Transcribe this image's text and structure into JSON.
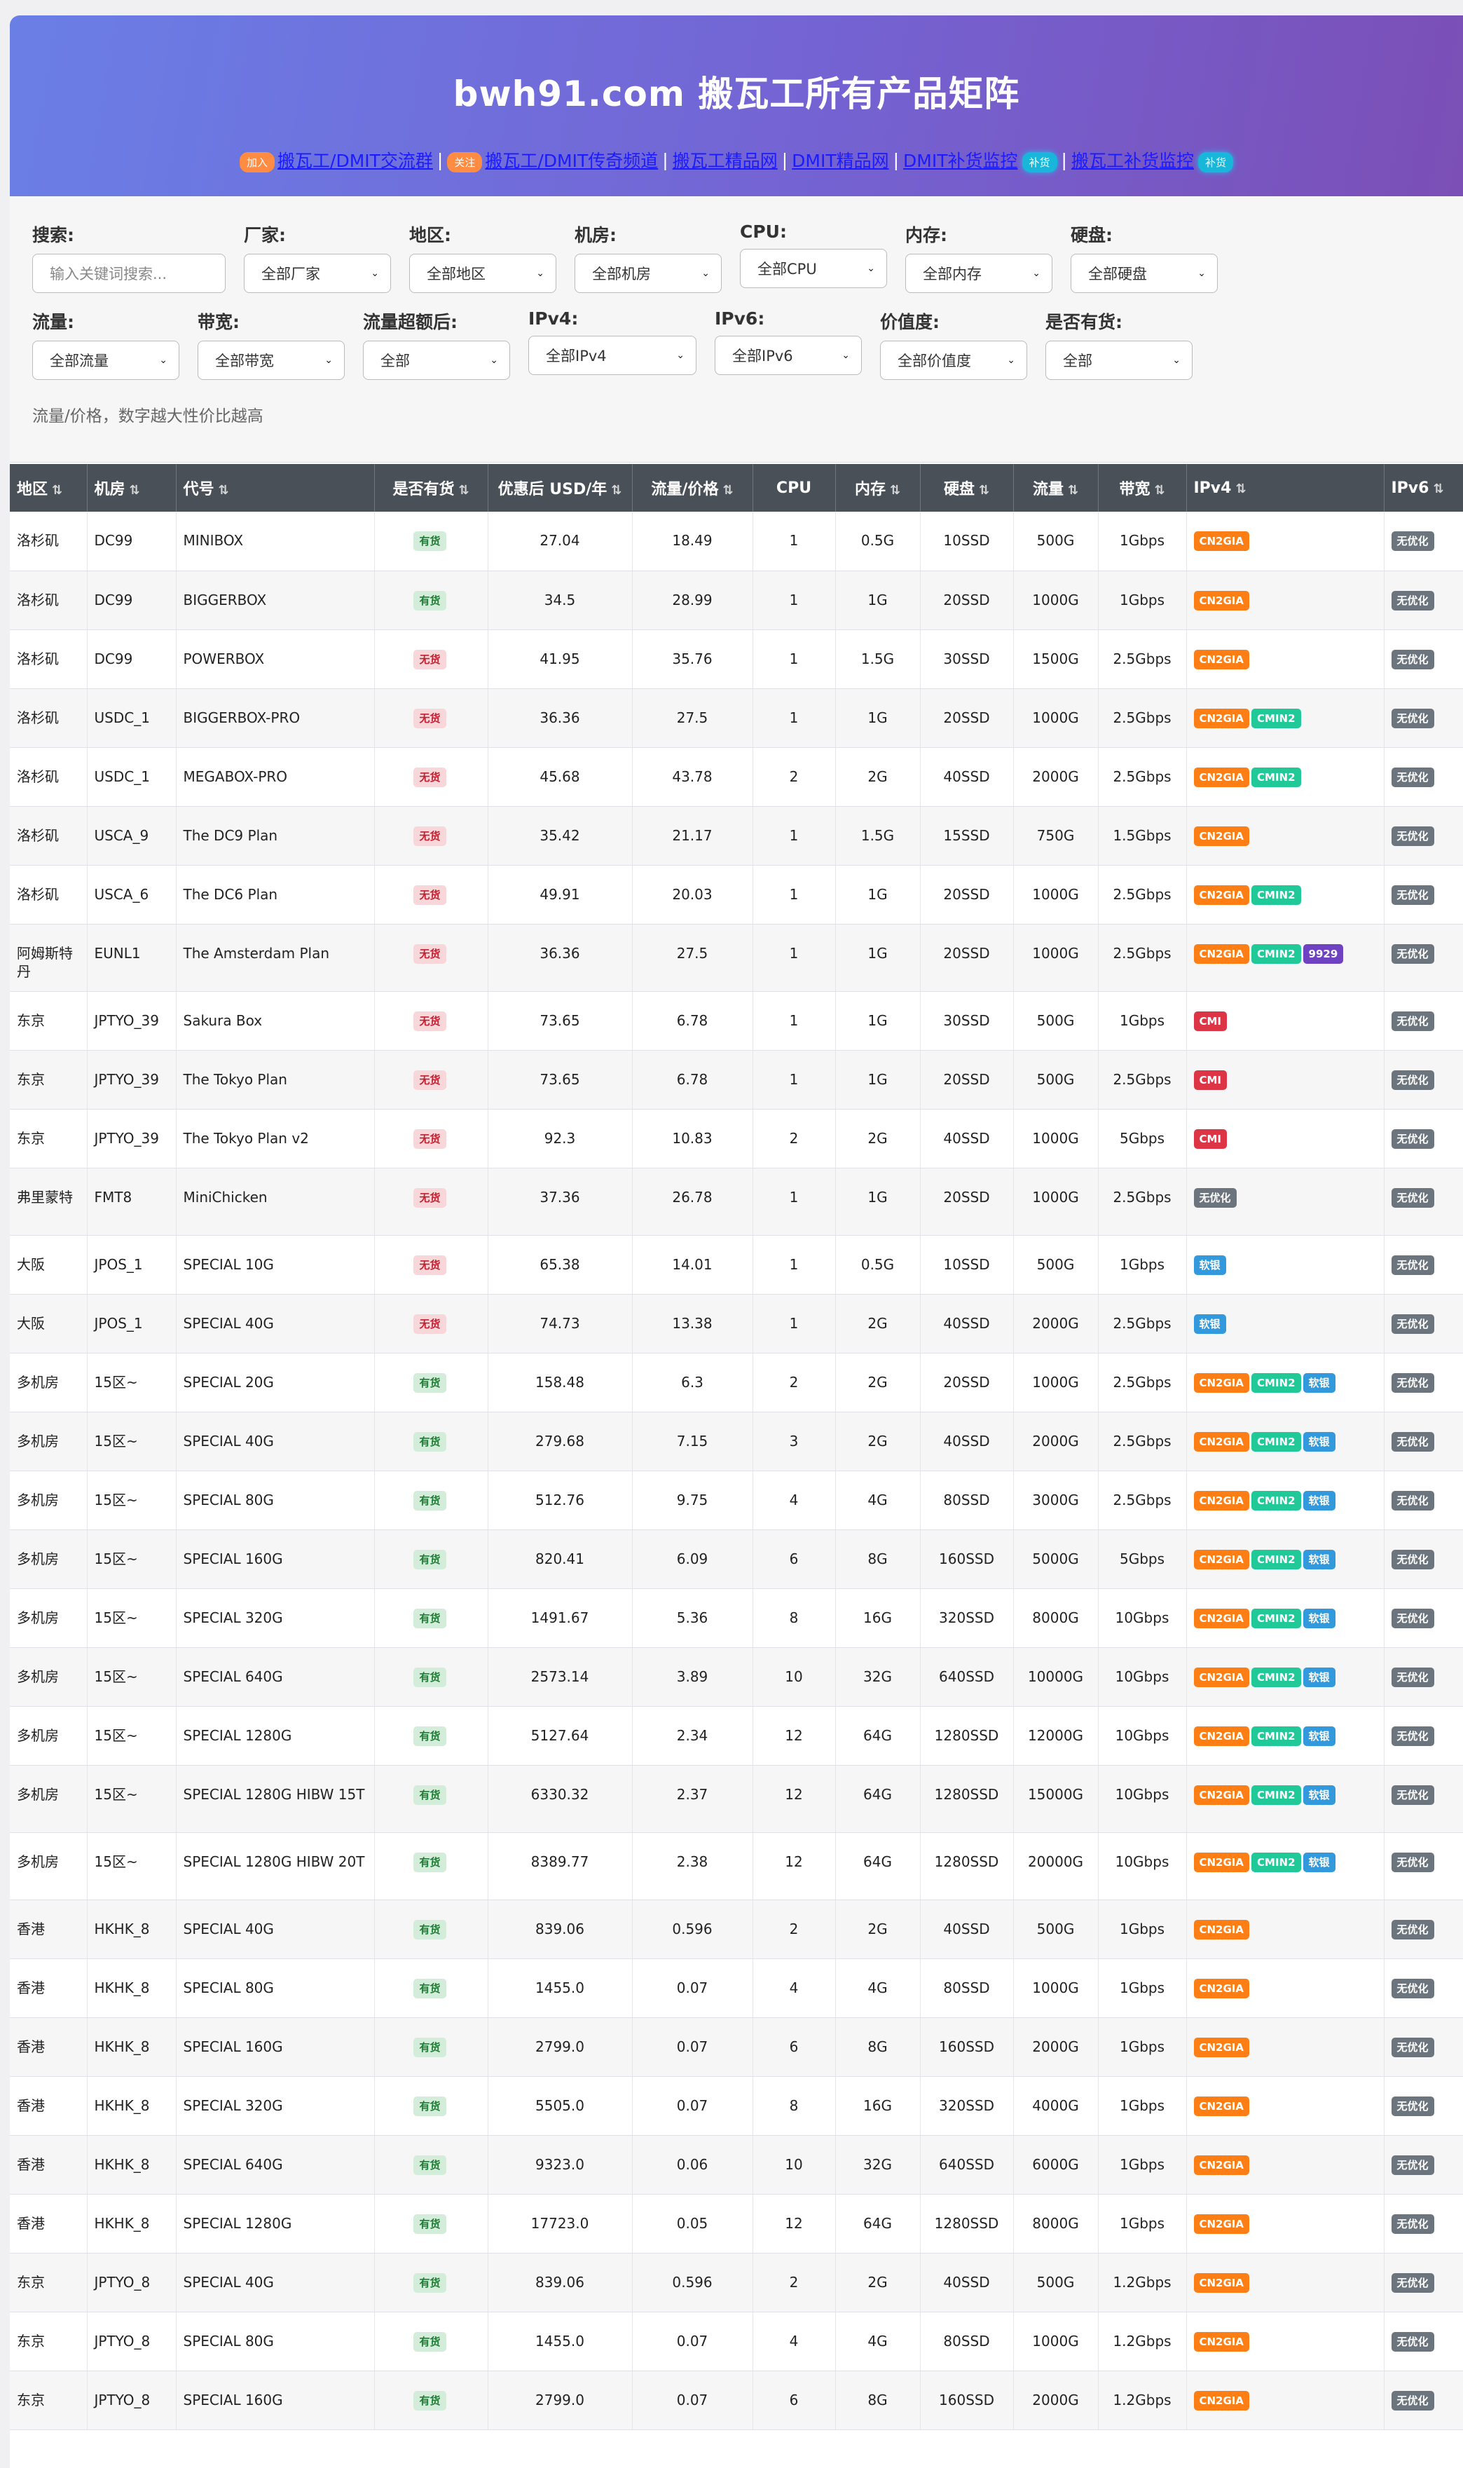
{
  "header": {
    "title": "bwh91.com 搬瓦工所有产品矩阵",
    "links": [
      {
        "pill": "加入",
        "pill_color": "orange",
        "text": "搬瓦工/DMIT交流群",
        "suffix": ""
      },
      {
        "pill": "关注",
        "pill_color": "orange",
        "text": "搬瓦工/DMIT传奇频道",
        "suffix": ""
      },
      {
        "pill": "",
        "pill_color": "",
        "text": "搬瓦工精品网",
        "suffix": ""
      },
      {
        "pill": "",
        "pill_color": "",
        "text": "DMIT精品网",
        "suffix": ""
      },
      {
        "pill": "",
        "pill_color": "",
        "text": "DMIT补货监控",
        "suffix": "补货"
      },
      {
        "pill": "",
        "pill_color": "",
        "text": "搬瓦工补货监控",
        "suffix": "补货"
      }
    ],
    "separator": "|"
  },
  "filters": {
    "row1": [
      {
        "label": "搜索:",
        "type": "input",
        "value": "",
        "placeholder": "输入关键词搜索..."
      },
      {
        "label": "厂家:",
        "type": "select",
        "value": "全部厂家"
      },
      {
        "label": "地区:",
        "type": "select",
        "value": "全部地区"
      },
      {
        "label": "机房:",
        "type": "select",
        "value": "全部机房"
      },
      {
        "label": "CPU:",
        "type": "select",
        "value": "全部CPU"
      },
      {
        "label": "内存:",
        "type": "select",
        "value": "全部内存"
      },
      {
        "label": "硬盘:",
        "type": "select",
        "value": "全部硬盘"
      }
    ],
    "row2": [
      {
        "label": "流量:",
        "type": "select",
        "value": "全部流量"
      },
      {
        "label": "带宽:",
        "type": "select",
        "value": "全部带宽"
      },
      {
        "label": "流量超额后:",
        "type": "select",
        "value": "全部"
      },
      {
        "label": "IPv4:",
        "type": "select",
        "value": "全部IPv4"
      },
      {
        "label": "IPv6:",
        "type": "select",
        "value": "全部IPv6"
      },
      {
        "label": "价值度:",
        "type": "select",
        "value": "全部价值度"
      },
      {
        "label": "是否有货:",
        "type": "select",
        "value": "全部"
      }
    ],
    "note": "流量/价格，数字越大性价比越高"
  },
  "table": {
    "columns": [
      "地区",
      "机房",
      "代号",
      "是否有货",
      "优惠后 USD/年",
      "流量/价格",
      "CPU",
      "内存",
      "硬盘",
      "流量",
      "带宽",
      "IPv4",
      "IPv6"
    ],
    "rows": [
      {
        "region": "洛杉矶",
        "dc": "DC99",
        "code": "MINIBOX",
        "stock": "有货",
        "price": "27.04",
        "ratio": "18.49",
        "cpu": "1",
        "ram": "0.5G",
        "disk": "10SSD",
        "traffic": "500G",
        "bw": "1Gbps",
        "ipv4": [
          "CN2GIA"
        ],
        "ipv6": [
          "无优化"
        ]
      },
      {
        "region": "洛杉矶",
        "dc": "DC99",
        "code": "BIGGERBOX",
        "stock": "有货",
        "price": "34.5",
        "ratio": "28.99",
        "cpu": "1",
        "ram": "1G",
        "disk": "20SSD",
        "traffic": "1000G",
        "bw": "1Gbps",
        "ipv4": [
          "CN2GIA"
        ],
        "ipv6": [
          "无优化"
        ]
      },
      {
        "region": "洛杉矶",
        "dc": "DC99",
        "code": "POWERBOX",
        "stock": "无货",
        "price": "41.95",
        "ratio": "35.76",
        "cpu": "1",
        "ram": "1.5G",
        "disk": "30SSD",
        "traffic": "1500G",
        "bw": "2.5Gbps",
        "ipv4": [
          "CN2GIA"
        ],
        "ipv6": [
          "无优化"
        ]
      },
      {
        "region": "洛杉矶",
        "dc": "USDC_1",
        "code": "BIGGERBOX-PRO",
        "stock": "无货",
        "price": "36.36",
        "ratio": "27.5",
        "cpu": "1",
        "ram": "1G",
        "disk": "20SSD",
        "traffic": "1000G",
        "bw": "2.5Gbps",
        "ipv4": [
          "CN2GIA",
          "CMIN2"
        ],
        "ipv6": [
          "无优化"
        ]
      },
      {
        "region": "洛杉矶",
        "dc": "USDC_1",
        "code": "MEGABOX-PRO",
        "stock": "无货",
        "price": "45.68",
        "ratio": "43.78",
        "cpu": "2",
        "ram": "2G",
        "disk": "40SSD",
        "traffic": "2000G",
        "bw": "2.5Gbps",
        "ipv4": [
          "CN2GIA",
          "CMIN2"
        ],
        "ipv6": [
          "无优化"
        ]
      },
      {
        "region": "洛杉矶",
        "dc": "USCA_9",
        "code": "The DC9 Plan",
        "stock": "无货",
        "price": "35.42",
        "ratio": "21.17",
        "cpu": "1",
        "ram": "1.5G",
        "disk": "15SSD",
        "traffic": "750G",
        "bw": "1.5Gbps",
        "ipv4": [
          "CN2GIA"
        ],
        "ipv6": [
          "无优化"
        ]
      },
      {
        "region": "洛杉矶",
        "dc": "USCA_6",
        "code": "The DC6 Plan",
        "stock": "无货",
        "price": "49.91",
        "ratio": "20.03",
        "cpu": "1",
        "ram": "1G",
        "disk": "20SSD",
        "traffic": "1000G",
        "bw": "2.5Gbps",
        "ipv4": [
          "CN2GIA",
          "CMIN2"
        ],
        "ipv6": [
          "无优化"
        ]
      },
      {
        "region": "阿姆斯特丹",
        "dc": "EUNL1",
        "code": "The Amsterdam Plan",
        "stock": "无货",
        "price": "36.36",
        "ratio": "27.5",
        "cpu": "1",
        "ram": "1G",
        "disk": "20SSD",
        "traffic": "1000G",
        "bw": "2.5Gbps",
        "ipv4": [
          "CN2GIA",
          "CMIN2",
          "9929"
        ],
        "ipv6": [
          "无优化"
        ]
      },
      {
        "region": "东京",
        "dc": "JPTYO_39",
        "code": "Sakura Box",
        "stock": "无货",
        "price": "73.65",
        "ratio": "6.78",
        "cpu": "1",
        "ram": "1G",
        "disk": "30SSD",
        "traffic": "500G",
        "bw": "1Gbps",
        "ipv4": [
          "CMI"
        ],
        "ipv6": [
          "无优化"
        ]
      },
      {
        "region": "东京",
        "dc": "JPTYO_39",
        "code": "The Tokyo Plan",
        "stock": "无货",
        "price": "73.65",
        "ratio": "6.78",
        "cpu": "1",
        "ram": "1G",
        "disk": "20SSD",
        "traffic": "500G",
        "bw": "2.5Gbps",
        "ipv4": [
          "CMI"
        ],
        "ipv6": [
          "无优化"
        ]
      },
      {
        "region": "东京",
        "dc": "JPTYO_39",
        "code": "The Tokyo Plan v2",
        "stock": "无货",
        "price": "92.3",
        "ratio": "10.83",
        "cpu": "2",
        "ram": "2G",
        "disk": "40SSD",
        "traffic": "1000G",
        "bw": "5Gbps",
        "ipv4": [
          "CMI"
        ],
        "ipv6": [
          "无优化"
        ]
      },
      {
        "region": "弗里蒙特",
        "dc": "FMT8",
        "code": "MiniChicken",
        "stock": "无货",
        "price": "37.36",
        "ratio": "26.78",
        "cpu": "1",
        "ram": "1G",
        "disk": "20SSD",
        "traffic": "1000G",
        "bw": "2.5Gbps",
        "ipv4": [
          "无优化"
        ],
        "ipv6": [
          "无优化"
        ]
      },
      {
        "region": "大阪",
        "dc": "JPOS_1",
        "code": "SPECIAL 10G",
        "stock": "无货",
        "price": "65.38",
        "ratio": "14.01",
        "cpu": "1",
        "ram": "0.5G",
        "disk": "10SSD",
        "traffic": "500G",
        "bw": "1Gbps",
        "ipv4": [
          "软银"
        ],
        "ipv6": [
          "无优化"
        ]
      },
      {
        "region": "大阪",
        "dc": "JPOS_1",
        "code": "SPECIAL 40G",
        "stock": "无货",
        "price": "74.73",
        "ratio": "13.38",
        "cpu": "1",
        "ram": "2G",
        "disk": "40SSD",
        "traffic": "2000G",
        "bw": "2.5Gbps",
        "ipv4": [
          "软银"
        ],
        "ipv6": [
          "无优化"
        ]
      },
      {
        "region": "多机房",
        "dc": "15区~",
        "code": "SPECIAL 20G",
        "stock": "有货",
        "price": "158.48",
        "ratio": "6.3",
        "cpu": "2",
        "ram": "2G",
        "disk": "20SSD",
        "traffic": "1000G",
        "bw": "2.5Gbps",
        "ipv4": [
          "CN2GIA",
          "CMIN2",
          "软银"
        ],
        "ipv6": [
          "无优化"
        ]
      },
      {
        "region": "多机房",
        "dc": "15区~",
        "code": "SPECIAL 40G",
        "stock": "有货",
        "price": "279.68",
        "ratio": "7.15",
        "cpu": "3",
        "ram": "2G",
        "disk": "40SSD",
        "traffic": "2000G",
        "bw": "2.5Gbps",
        "ipv4": [
          "CN2GIA",
          "CMIN2",
          "软银"
        ],
        "ipv6": [
          "无优化"
        ]
      },
      {
        "region": "多机房",
        "dc": "15区~",
        "code": "SPECIAL 80G",
        "stock": "有货",
        "price": "512.76",
        "ratio": "9.75",
        "cpu": "4",
        "ram": "4G",
        "disk": "80SSD",
        "traffic": "3000G",
        "bw": "2.5Gbps",
        "ipv4": [
          "CN2GIA",
          "CMIN2",
          "软银"
        ],
        "ipv6": [
          "无优化"
        ]
      },
      {
        "region": "多机房",
        "dc": "15区~",
        "code": "SPECIAL 160G",
        "stock": "有货",
        "price": "820.41",
        "ratio": "6.09",
        "cpu": "6",
        "ram": "8G",
        "disk": "160SSD",
        "traffic": "5000G",
        "bw": "5Gbps",
        "ipv4": [
          "CN2GIA",
          "CMIN2",
          "软银"
        ],
        "ipv6": [
          "无优化"
        ]
      },
      {
        "region": "多机房",
        "dc": "15区~",
        "code": "SPECIAL 320G",
        "stock": "有货",
        "price": "1491.67",
        "ratio": "5.36",
        "cpu": "8",
        "ram": "16G",
        "disk": "320SSD",
        "traffic": "8000G",
        "bw": "10Gbps",
        "ipv4": [
          "CN2GIA",
          "CMIN2",
          "软银"
        ],
        "ipv6": [
          "无优化"
        ]
      },
      {
        "region": "多机房",
        "dc": "15区~",
        "code": "SPECIAL 640G",
        "stock": "有货",
        "price": "2573.14",
        "ratio": "3.89",
        "cpu": "10",
        "ram": "32G",
        "disk": "640SSD",
        "traffic": "10000G",
        "bw": "10Gbps",
        "ipv4": [
          "CN2GIA",
          "CMIN2",
          "软银"
        ],
        "ipv6": [
          "无优化"
        ]
      },
      {
        "region": "多机房",
        "dc": "15区~",
        "code": "SPECIAL 1280G",
        "stock": "有货",
        "price": "5127.64",
        "ratio": "2.34",
        "cpu": "12",
        "ram": "64G",
        "disk": "1280SSD",
        "traffic": "12000G",
        "bw": "10Gbps",
        "ipv4": [
          "CN2GIA",
          "CMIN2",
          "软银"
        ],
        "ipv6": [
          "无优化"
        ]
      },
      {
        "region": "多机房",
        "dc": "15区~",
        "code": "SPECIAL 1280G HIBW 15T",
        "stock": "有货",
        "price": "6330.32",
        "ratio": "2.37",
        "cpu": "12",
        "ram": "64G",
        "disk": "1280SSD",
        "traffic": "15000G",
        "bw": "10Gbps",
        "ipv4": [
          "CN2GIA",
          "CMIN2",
          "软银"
        ],
        "ipv6": [
          "无优化"
        ]
      },
      {
        "region": "多机房",
        "dc": "15区~",
        "code": "SPECIAL 1280G HIBW 20T",
        "stock": "有货",
        "price": "8389.77",
        "ratio": "2.38",
        "cpu": "12",
        "ram": "64G",
        "disk": "1280SSD",
        "traffic": "20000G",
        "bw": "10Gbps",
        "ipv4": [
          "CN2GIA",
          "CMIN2",
          "软银"
        ],
        "ipv6": [
          "无优化"
        ]
      },
      {
        "region": "香港",
        "dc": "HKHK_8",
        "code": "SPECIAL 40G",
        "stock": "有货",
        "price": "839.06",
        "ratio": "0.596",
        "cpu": "2",
        "ram": "2G",
        "disk": "40SSD",
        "traffic": "500G",
        "bw": "1Gbps",
        "ipv4": [
          "CN2GIA"
        ],
        "ipv6": [
          "无优化"
        ]
      },
      {
        "region": "香港",
        "dc": "HKHK_8",
        "code": "SPECIAL 80G",
        "stock": "有货",
        "price": "1455.0",
        "ratio": "0.07",
        "cpu": "4",
        "ram": "4G",
        "disk": "80SSD",
        "traffic": "1000G",
        "bw": "1Gbps",
        "ipv4": [
          "CN2GIA"
        ],
        "ipv6": [
          "无优化"
        ]
      },
      {
        "region": "香港",
        "dc": "HKHK_8",
        "code": "SPECIAL 160G",
        "stock": "有货",
        "price": "2799.0",
        "ratio": "0.07",
        "cpu": "6",
        "ram": "8G",
        "disk": "160SSD",
        "traffic": "2000G",
        "bw": "1Gbps",
        "ipv4": [
          "CN2GIA"
        ],
        "ipv6": [
          "无优化"
        ]
      },
      {
        "region": "香港",
        "dc": "HKHK_8",
        "code": "SPECIAL 320G",
        "stock": "有货",
        "price": "5505.0",
        "ratio": "0.07",
        "cpu": "8",
        "ram": "16G",
        "disk": "320SSD",
        "traffic": "4000G",
        "bw": "1Gbps",
        "ipv4": [
          "CN2GIA"
        ],
        "ipv6": [
          "无优化"
        ]
      },
      {
        "region": "香港",
        "dc": "HKHK_8",
        "code": "SPECIAL 640G",
        "stock": "有货",
        "price": "9323.0",
        "ratio": "0.06",
        "cpu": "10",
        "ram": "32G",
        "disk": "640SSD",
        "traffic": "6000G",
        "bw": "1Gbps",
        "ipv4": [
          "CN2GIA"
        ],
        "ipv6": [
          "无优化"
        ]
      },
      {
        "region": "香港",
        "dc": "HKHK_8",
        "code": "SPECIAL 1280G",
        "stock": "有货",
        "price": "17723.0",
        "ratio": "0.05",
        "cpu": "12",
        "ram": "64G",
        "disk": "1280SSD",
        "traffic": "8000G",
        "bw": "1Gbps",
        "ipv4": [
          "CN2GIA"
        ],
        "ipv6": [
          "无优化"
        ]
      },
      {
        "region": "东京",
        "dc": "JPTYO_8",
        "code": "SPECIAL 40G",
        "stock": "有货",
        "price": "839.06",
        "ratio": "0.596",
        "cpu": "2",
        "ram": "2G",
        "disk": "40SSD",
        "traffic": "500G",
        "bw": "1.2Gbps",
        "ipv4": [
          "CN2GIA"
        ],
        "ipv6": [
          "无优化"
        ]
      },
      {
        "region": "东京",
        "dc": "JPTYO_8",
        "code": "SPECIAL 80G",
        "stock": "有货",
        "price": "1455.0",
        "ratio": "0.07",
        "cpu": "4",
        "ram": "4G",
        "disk": "80SSD",
        "traffic": "1000G",
        "bw": "1.2Gbps",
        "ipv4": [
          "CN2GIA"
        ],
        "ipv6": [
          "无优化"
        ]
      },
      {
        "region": "东京",
        "dc": "JPTYO_8",
        "code": "SPECIAL 160G",
        "stock": "有货",
        "price": "2799.0",
        "ratio": "0.07",
        "cpu": "6",
        "ram": "8G",
        "disk": "160SSD",
        "traffic": "2000G",
        "bw": "1.2Gbps",
        "ipv4": [
          "CN2GIA"
        ],
        "ipv6": [
          "无优化"
        ]
      }
    ]
  },
  "badge_colors": {
    "CN2GIA": "#fd7e14",
    "CMIN2": "#20c997",
    "软银": "#3399dd",
    "CMI": "#dc3545",
    "9929": "#6f42c1",
    "无优化": "#6c757d"
  }
}
